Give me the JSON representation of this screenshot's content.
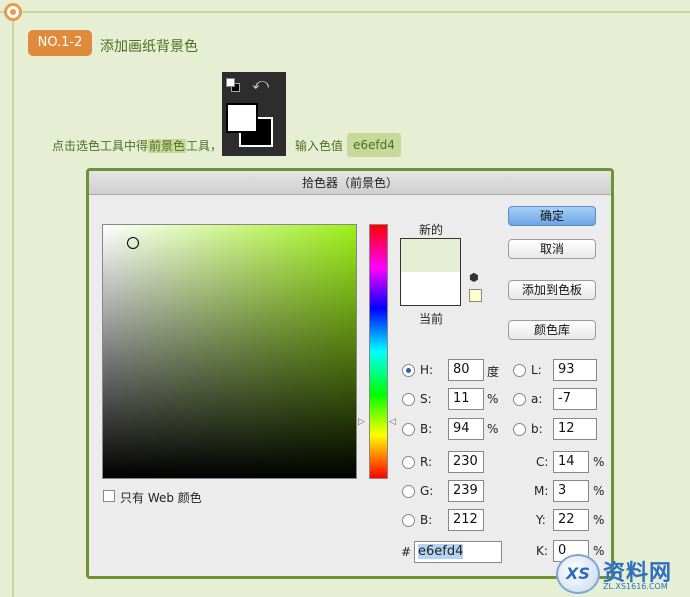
{
  "step": {
    "badge": "NO.1-2",
    "title": "添加画纸背景色"
  },
  "instruction": {
    "part1": "点击选色工具中得",
    "highlight": "前景色",
    "part2": "工具，",
    "part3": "输入色值",
    "value": "e6efd4"
  },
  "dialog": {
    "title": "拾色器（前景色）",
    "new_label": "新的",
    "current_label": "当前",
    "buttons": {
      "ok": "确定",
      "cancel": "取消",
      "add_swatch": "添加到色板",
      "library": "颜色库"
    },
    "hsb": {
      "h": {
        "label": "H:",
        "value": "80",
        "unit": "度"
      },
      "s": {
        "label": "S:",
        "value": "11",
        "unit": "%"
      },
      "b": {
        "label": "B:",
        "value": "94",
        "unit": "%"
      }
    },
    "rgb": {
      "r": {
        "label": "R:",
        "value": "230"
      },
      "g": {
        "label": "G:",
        "value": "239"
      },
      "b": {
        "label": "B:",
        "value": "212"
      }
    },
    "lab": {
      "l": {
        "label": "L:",
        "value": "93"
      },
      "a": {
        "label": "a:",
        "value": "-7"
      },
      "b": {
        "label": "b:",
        "value": "12"
      }
    },
    "cmyk": {
      "c": {
        "label": "C:",
        "value": "14",
        "unit": "%"
      },
      "m": {
        "label": "M:",
        "value": "3",
        "unit": "%"
      },
      "y": {
        "label": "Y:",
        "value": "22",
        "unit": "%"
      },
      "k": {
        "label": "K:",
        "value": "0",
        "unit": "%"
      }
    },
    "hex": {
      "label": "#",
      "value": "e6efd4"
    },
    "web_only_label": "只有 Web 颜色"
  },
  "colors": {
    "new": "#e6efd4",
    "current": "#ffffff",
    "accent": "#6d9334",
    "badge": "#e08a3c"
  },
  "icons": [
    "swap-icon",
    "cube-icon"
  ],
  "watermark": {
    "logo": "XS",
    "name": "资料网",
    "url": "ZL.XS1616.COM"
  }
}
